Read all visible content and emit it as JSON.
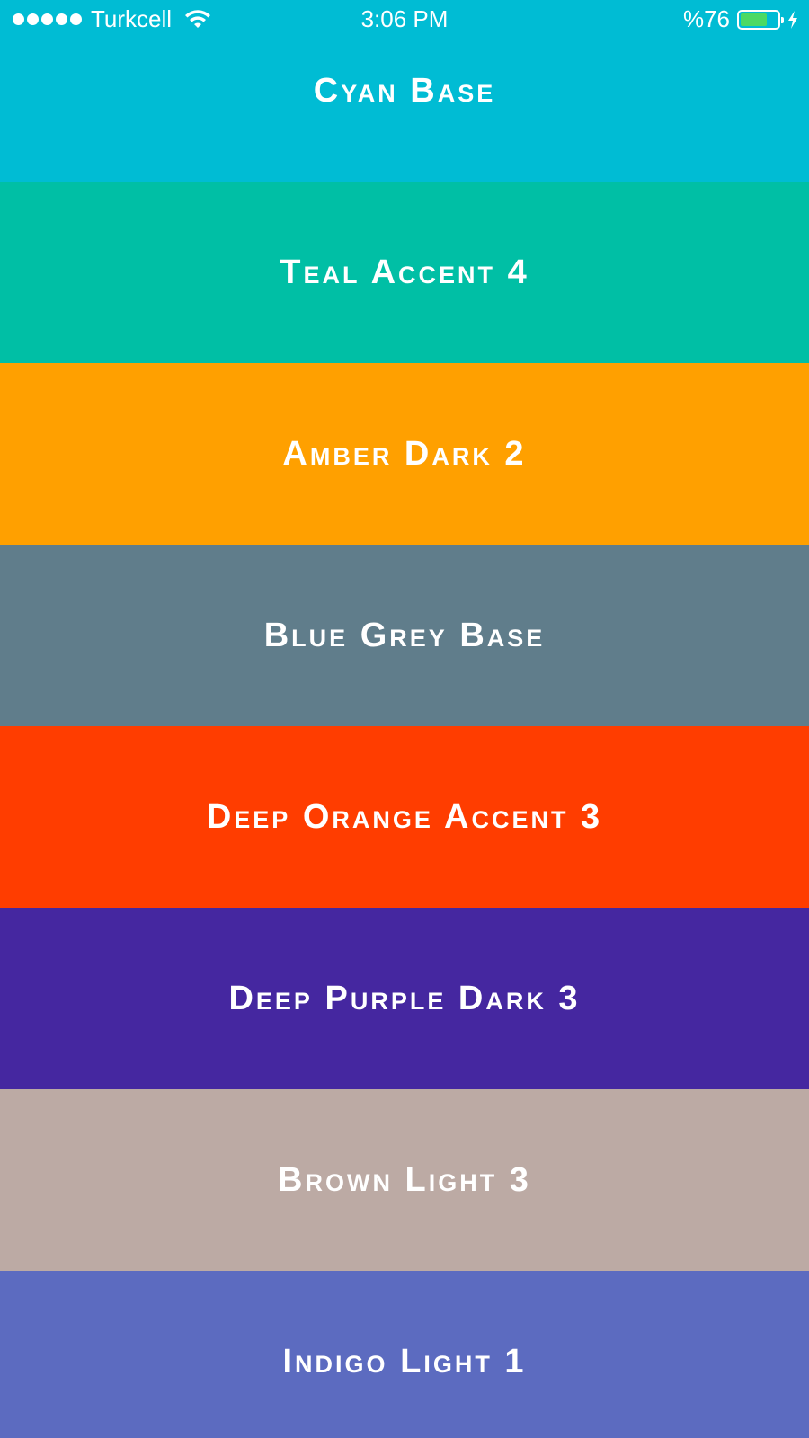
{
  "status_bar": {
    "carrier": "Turkcell",
    "time": "3:06 PM",
    "battery_percent": "%76",
    "battery_level": 0.76,
    "signal_bars": 5,
    "battery_color": "#4cd964"
  },
  "colors": [
    {
      "name": "Cyan Base",
      "hex": "#00BCD4"
    },
    {
      "name": "Teal Accent 4",
      "hex": "#00BFA5"
    },
    {
      "name": "Amber Dark 2",
      "hex": "#FFA000"
    },
    {
      "name": "Blue Grey Base",
      "hex": "#607D8B"
    },
    {
      "name": "Deep Orange Accent 3",
      "hex": "#FF3D00"
    },
    {
      "name": "Deep Purple Dark 3",
      "hex": "#4527A0"
    },
    {
      "name": "Brown Light 3",
      "hex": "#BCAAA4"
    },
    {
      "name": "Indigo Light 1",
      "hex": "#5C6BC0"
    }
  ]
}
